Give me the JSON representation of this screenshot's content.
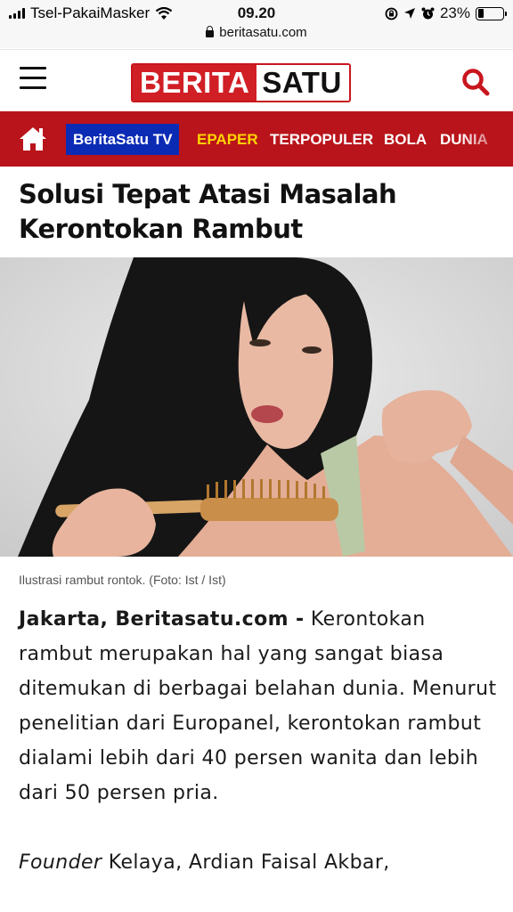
{
  "status_bar": {
    "carrier": "Tsel-PakaiMasker",
    "time": "09.20",
    "battery": "23%",
    "battery_level": 0.23
  },
  "browser": {
    "url": "beritasatu.com"
  },
  "header": {
    "logo_part1": "BERITA",
    "logo_part2": "SATU"
  },
  "nav": {
    "tv": "BeritaSatu TV",
    "epaper": "EPAPER",
    "terpopuler": "TERPOPULER",
    "bola": "BOLA",
    "dunia": "DUNIA"
  },
  "article": {
    "title": "Solusi Tepat Atasi Masalah Kerontokan Rambut",
    "caption": "Ilustrasi rambut rontok. (Foto: Ist / Ist)",
    "dateline": "Jakarta, Beritasatu.com -",
    "paragraph1": " Kerontokan rambut merupakan hal yang sangat biasa ditemukan di berbagai belahan dunia. Menurut penelitian dari Europanel, kerontokan rambut dialami lebih dari 40 persen wanita dan lebih dari 50 persen pria.",
    "p2_italic": "Founder",
    "p2_text": " Kelaya, Ardian Faisal Akbar,"
  },
  "colors": {
    "brand_red": "#d11f26",
    "nav_red": "#b9141b",
    "tv_blue": "#0b2bb5",
    "epaper_yellow": "#ffd400"
  }
}
